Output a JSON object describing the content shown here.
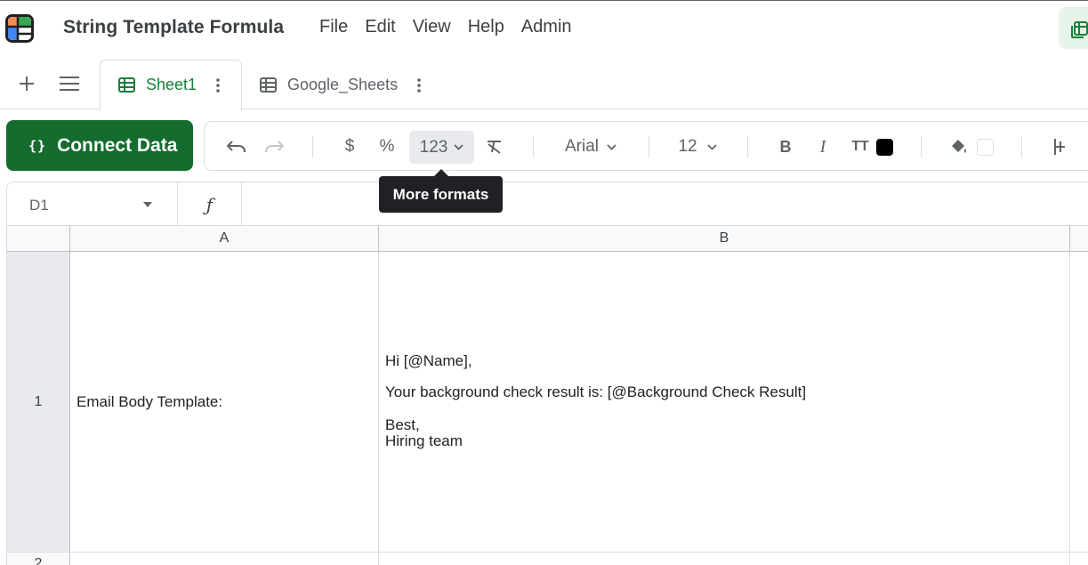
{
  "app": {
    "title": "String Template Formula",
    "menu": [
      "File",
      "Edit",
      "View",
      "Help",
      "Admin"
    ]
  },
  "tabs": [
    {
      "label": "Sheet1",
      "active": true
    },
    {
      "label": "Google_Sheets",
      "active": false
    }
  ],
  "toolbar": {
    "connect_label": "Connect Data",
    "connect_icon": "{}",
    "currency_symbol": "$",
    "percent_symbol": "%",
    "number_format_label": "123",
    "font_family_value": "Arial",
    "font_size_value": "12",
    "bold_label": "B",
    "italic_label": "I",
    "text_size_label": "TT",
    "text_color": "#000000",
    "fill_color": "#ffffff",
    "tooltip": "More formats"
  },
  "formula_bar": {
    "cell_ref": "D1",
    "fx_symbol": "ƒ",
    "value": ""
  },
  "grid": {
    "columns": [
      "A",
      "B"
    ],
    "rows": [
      {
        "number": "1",
        "a": "Email Body Template:",
        "b_lines": [
          "Hi [@Name],",
          "Your background check result is: [@Background Check Result]",
          "Best,",
          "Hiring team"
        ]
      },
      {
        "number": "2",
        "a": "",
        "b_lines": []
      }
    ]
  },
  "colors": {
    "brand_green": "#146c2e",
    "active_tab_green": "#188038"
  }
}
